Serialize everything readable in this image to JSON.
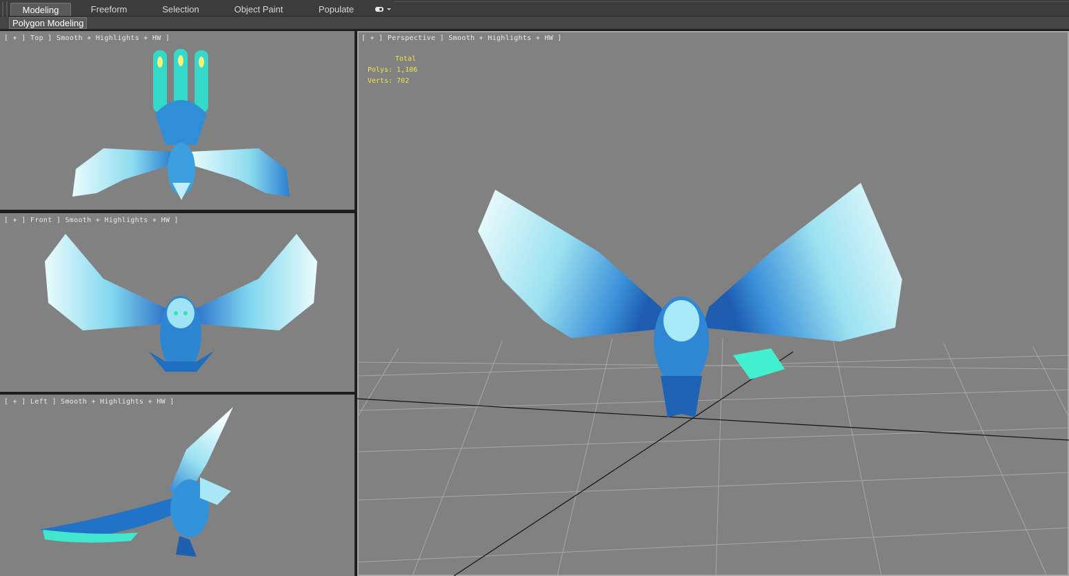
{
  "ribbon": {
    "tabs": [
      {
        "label": "Modeling",
        "active": true
      },
      {
        "label": "Freeform",
        "active": false
      },
      {
        "label": "Selection",
        "active": false
      },
      {
        "label": "Object Paint",
        "active": false
      },
      {
        "label": "Populate",
        "active": false
      }
    ],
    "extra_icon": "toggle-dropdown-icon"
  },
  "subribbon": {
    "panel_label": "Polygon Modeling"
  },
  "viewports": {
    "top": {
      "label": "[ + ] Top ] Smooth + Highlights + HW ]"
    },
    "front": {
      "label": "[ + ] Front ] Smooth + Highlights + HW ]"
    },
    "left": {
      "label": "[ + ] Left ] Smooth + Highlights + HW ]"
    },
    "perspective": {
      "label": "[ + ] Perspective ] Smooth + Highlights + HW ]",
      "stats": {
        "header": "Total",
        "polys_label": "Polys:",
        "polys_value": "1,106",
        "verts_label": "Verts:",
        "verts_value": "702"
      }
    }
  },
  "colors": {
    "viewport_bg": "#818181",
    "stats_text": "#f2e64a",
    "model_light": "#dff8fb",
    "model_mid": "#5fc9e6",
    "model_dark": "#1f5fb0",
    "model_glow": "#3ff0d0"
  }
}
